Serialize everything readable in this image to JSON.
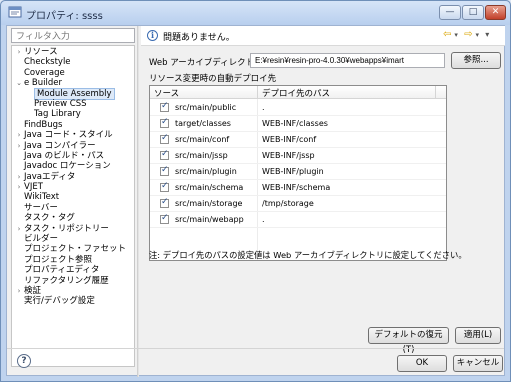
{
  "window": {
    "title": "プロパティ: ssss",
    "minimize_label": "—",
    "maximize_label": "□",
    "close_label": "✕"
  },
  "filter": {
    "placeholder": "フィルタ入力"
  },
  "tree": {
    "items": [
      {
        "label": "リソース",
        "level": 0,
        "arrow": "›"
      },
      {
        "label": "Checkstyle",
        "level": 0,
        "arrow": ""
      },
      {
        "label": "Coverage",
        "level": 0,
        "arrow": ""
      },
      {
        "label": "e Builder",
        "level": 0,
        "arrow": "⌄"
      },
      {
        "label": "Module Assembly",
        "level": 1,
        "arrow": "",
        "selected": true
      },
      {
        "label": "Preview CSS",
        "level": 1,
        "arrow": ""
      },
      {
        "label": "Tag Library",
        "level": 1,
        "arrow": ""
      },
      {
        "label": "FindBugs",
        "level": 0,
        "arrow": ""
      },
      {
        "label": "Java コード・スタイル",
        "level": 0,
        "arrow": "›"
      },
      {
        "label": "Java コンパイラー",
        "level": 0,
        "arrow": "›"
      },
      {
        "label": "Java のビルド・パス",
        "level": 0,
        "arrow": ""
      },
      {
        "label": "Javadoc ロケーション",
        "level": 0,
        "arrow": ""
      },
      {
        "label": "Javaエディタ",
        "level": 0,
        "arrow": "›"
      },
      {
        "label": "VJET",
        "level": 0,
        "arrow": "›"
      },
      {
        "label": "WikiText",
        "level": 0,
        "arrow": ""
      },
      {
        "label": "サーバー",
        "level": 0,
        "arrow": ""
      },
      {
        "label": "タスク・タグ",
        "level": 0,
        "arrow": ""
      },
      {
        "label": "タスク・リポジトリー",
        "level": 0,
        "arrow": "›"
      },
      {
        "label": "ビルダー",
        "level": 0,
        "arrow": ""
      },
      {
        "label": "プロジェクト・ファセット",
        "level": 0,
        "arrow": ""
      },
      {
        "label": "プロジェクト参照",
        "level": 0,
        "arrow": ""
      },
      {
        "label": "プロパティエディタ",
        "level": 0,
        "arrow": ""
      },
      {
        "label": "リファクタリング履歴",
        "level": 0,
        "arrow": ""
      },
      {
        "label": "検証",
        "level": 0,
        "arrow": "›"
      },
      {
        "label": "実行/デバッグ設定",
        "level": 0,
        "arrow": ""
      }
    ]
  },
  "message": {
    "text": "問題ありません。",
    "info_icon": "i",
    "nav_back": "⇦",
    "nav_back_dd": "▾",
    "nav_forward": "⇨",
    "nav_forward_dd": "▾",
    "menu": "▾"
  },
  "archive": {
    "label": "Web アーカイブディレクトリ",
    "path": "E:¥resin¥resin-pro-4.0.30¥webapps¥imart",
    "browse_label": "参照..."
  },
  "section_label": "リソース変更時の自動デプロイ先",
  "table": {
    "headers": [
      "ソース",
      "デプロイ先のパス"
    ],
    "rows": [
      {
        "source": "src/main/public",
        "dest": ".",
        "checked": true
      },
      {
        "source": "target/classes",
        "dest": "WEB-INF/classes",
        "checked": true
      },
      {
        "source": "src/main/conf",
        "dest": "WEB-INF/conf",
        "checked": true
      },
      {
        "source": "src/main/jssp",
        "dest": "WEB-INF/jssp",
        "checked": true
      },
      {
        "source": "src/main/plugin",
        "dest": "WEB-INF/plugin",
        "checked": true
      },
      {
        "source": "src/main/schema",
        "dest": "WEB-INF/schema",
        "checked": true
      },
      {
        "source": "src/main/storage",
        "dest": "/tmp/storage",
        "checked": true
      },
      {
        "source": "src/main/webapp",
        "dest": ".",
        "checked": true
      }
    ]
  },
  "note": "注: デプロイ先のパスの設定値は Web アーカイブディレクトリに設定してください。",
  "buttons": {
    "restore": "デフォルトの復元(T)",
    "apply": "適用(L)",
    "ok": "OK",
    "cancel": "キャンセル",
    "help": "?"
  },
  "colors": {
    "title_gradient_top": "#d6e4f7",
    "close_button": "#c2402a",
    "selection": "#dde9f8",
    "nav_arrows": "#d9a400"
  }
}
